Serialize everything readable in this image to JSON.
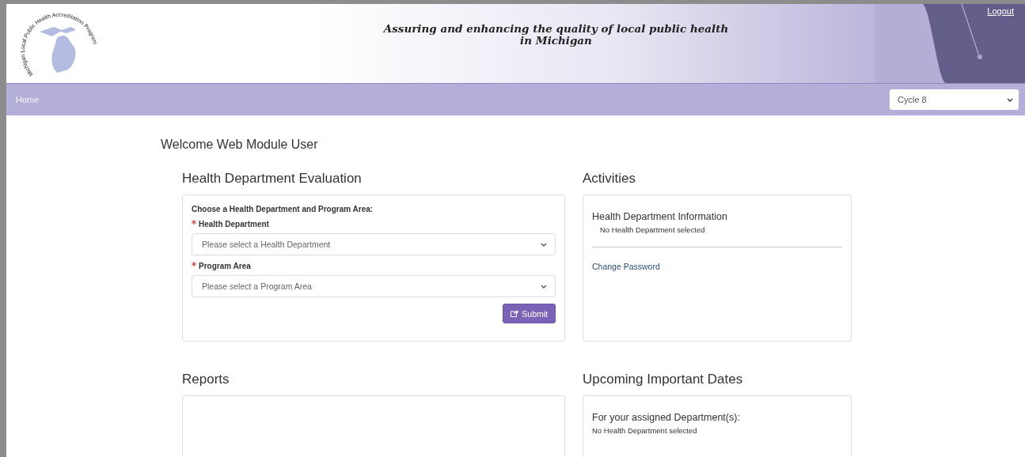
{
  "header": {
    "logo_text": "Michigan Local Public Health Accreditation Program",
    "tagline_line1": "Assuring and enhancing the quality of local public health",
    "tagline_line2": "in Michigan",
    "logout": "Logout"
  },
  "nav": {
    "home": "Home",
    "cycle": "Cycle 8"
  },
  "welcome": "Welcome Web Module User",
  "evaluation": {
    "title": "Health Department Evaluation",
    "intro": "Choose a Health Department and Program Area:",
    "fields": [
      {
        "required": true,
        "label": "Health Department",
        "placeholder": "Please select a Health Department"
      },
      {
        "required": true,
        "label": "Program Area",
        "placeholder": "Please select a Program Area"
      }
    ],
    "submit": "Submit"
  },
  "activities": {
    "title": "Activities",
    "info_title": "Health Department Information",
    "info_text": "No Health Department selected",
    "link": "Change Password"
  },
  "reports": {
    "title": "Reports"
  },
  "dates": {
    "title": "Upcoming Important Dates",
    "subtitle": "For your assigned Department(s):",
    "text": "No Health Department selected"
  }
}
